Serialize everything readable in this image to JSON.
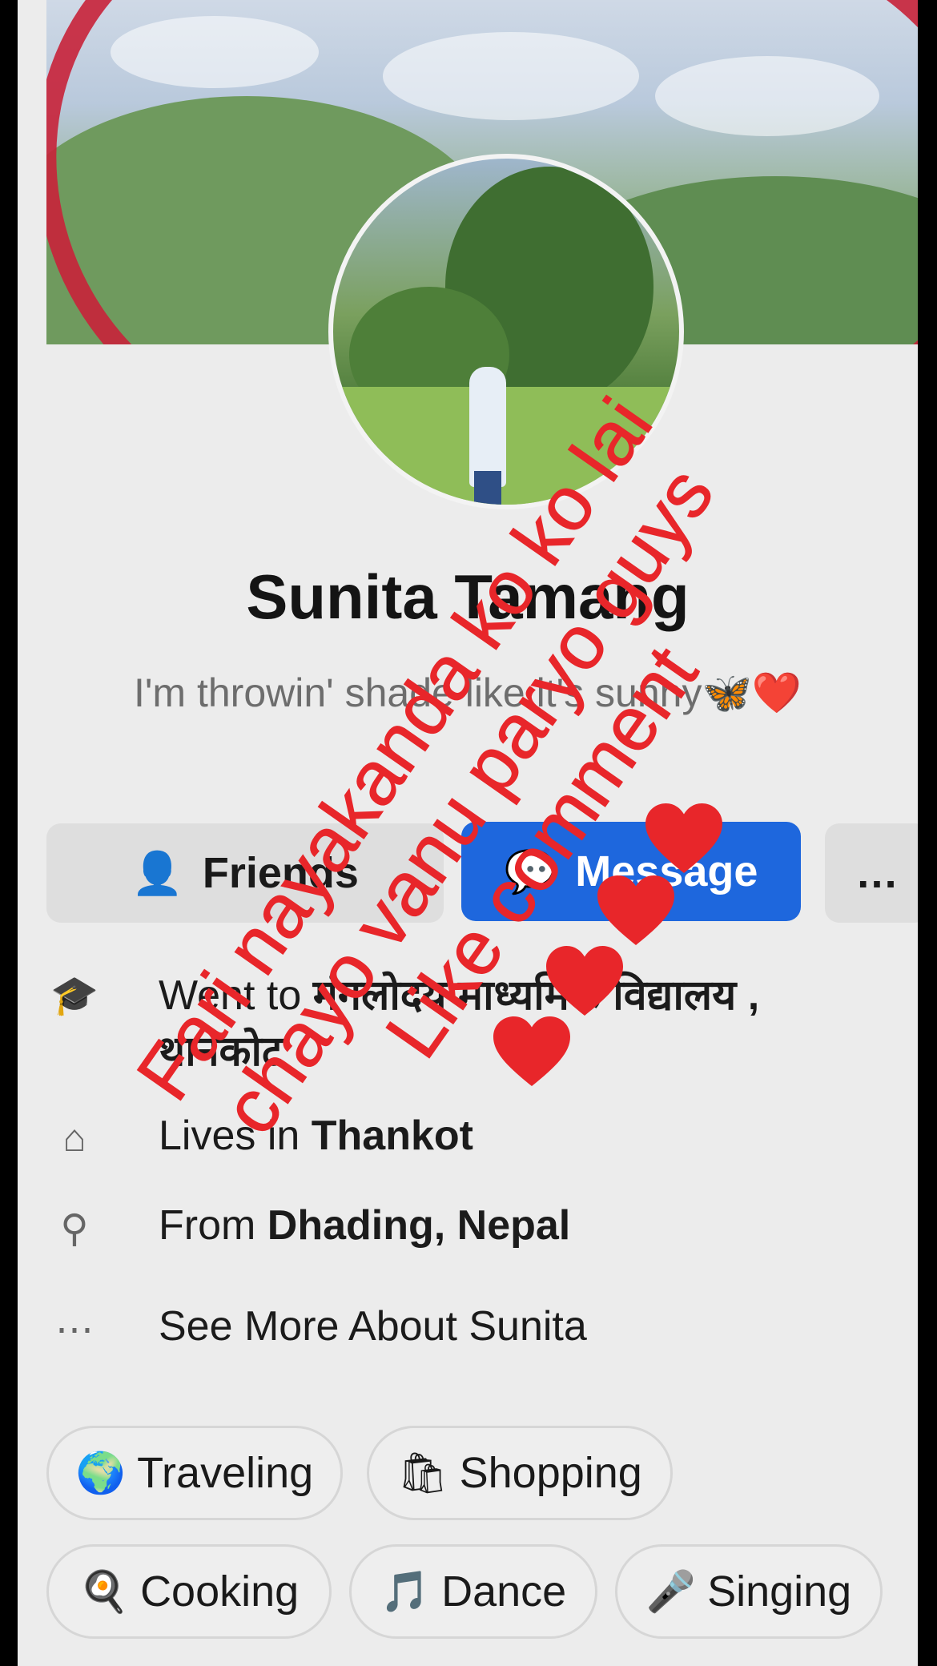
{
  "profile": {
    "name": "Sunita Tamang",
    "bio": "I'm throwin' shade like it's sunny🦋❤️"
  },
  "buttons": {
    "friends": "Friends",
    "message": "Message",
    "more": "…"
  },
  "about": {
    "education_prefix": "Went to ",
    "education_value": "मंगलोदय माध्यमिक विद्यालय , थानकोट",
    "lives_prefix": "Lives in ",
    "lives_value": "Thankot",
    "from_prefix": "From ",
    "from_value": "Dhading, Nepal",
    "see_more": "See More About Sunita"
  },
  "interests": [
    {
      "icon": "🌍",
      "label": "Traveling"
    },
    {
      "icon": "🛍",
      "label": "Shopping"
    },
    {
      "icon": "🍳",
      "label": "Cooking"
    },
    {
      "icon": "🎵",
      "label": "Dance"
    },
    {
      "icon": "🎤",
      "label": "Singing"
    }
  ],
  "overlay_text": {
    "line1": "Fari nayakanda ko ko lai",
    "line2": "chayo vanu paryo guys",
    "line3": "Like comment"
  },
  "colors": {
    "accent": "#1e67dd",
    "overlay": "#e8262a"
  }
}
